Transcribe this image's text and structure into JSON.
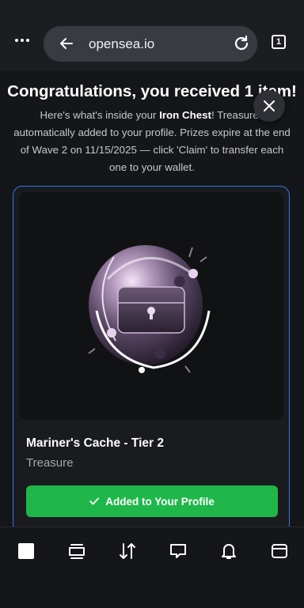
{
  "browser": {
    "url": "opensea.io",
    "tab_count": "1"
  },
  "modal": {
    "title": "Congratulations, you received 1 item!",
    "description_prefix": "Here's what's inside your ",
    "chest_name": "Iron Chest",
    "description_suffix": "! Treasures automatically added to your profile. Prizes expire at the end of Wave 2 on 11/15/2025 — click 'Claim' to transfer each one to your wallet.",
    "item": {
      "name": "Mariner's Cache - Tier 2",
      "type": "Treasure",
      "status_label": "Added to Your Profile"
    }
  },
  "colors": {
    "accent": "#2d7bea",
    "success": "#1fb749",
    "background": "#151619"
  },
  "bottom_nav": [
    "home-icon",
    "cards-icon",
    "swap-icon",
    "chat-icon",
    "bell-icon",
    "wallet-icon"
  ]
}
